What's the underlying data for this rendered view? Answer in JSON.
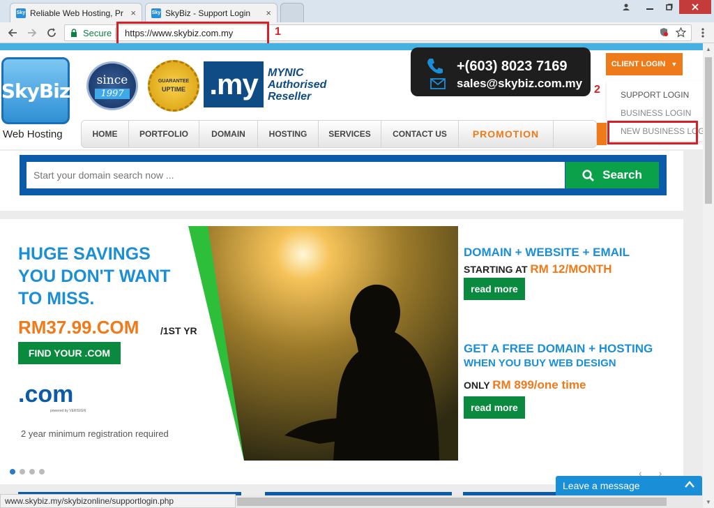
{
  "browser": {
    "tabs": [
      {
        "title": "Reliable Web Hosting, Pr",
        "favicon": "skybiz-favicon"
      },
      {
        "title": "SkyBiz - Support Login",
        "favicon": "skybiz-favicon"
      }
    ],
    "close_glyph": "×",
    "address": {
      "secure_label": "Secure",
      "url": "https://www.skybiz.com.my"
    },
    "annotations": {
      "url_marker": "1",
      "support_marker": "2"
    },
    "status_url": "www.skybiz.my/skybizonline/supportlogin.php"
  },
  "header": {
    "logo_text": "SkyBiz",
    "logo_sub": "Web Hosting",
    "since_label": "since",
    "since_year": "1997",
    "guarantee_label": "GUARANTEE",
    "guarantee_sub": "UPTIME",
    "my_badge": ".my",
    "mynic_lines": [
      "MYNIC",
      "Authorised",
      "Reseller"
    ],
    "phone": "+(603) 8023 7169",
    "email": "sales@skybiz.com.my",
    "client_login_label": "CLIENT LOGIN",
    "dropdown": [
      "SUPPORT LOGIN",
      "BUSINESS LOGIN",
      "NEW BUSINESS LOG"
    ],
    "nav": [
      "HOME",
      "PORTFOLIO",
      "DOMAIN",
      "HOSTING",
      "SERVICES",
      "CONTACT US",
      "PROMOTION"
    ]
  },
  "search": {
    "placeholder": "Start your domain search now ...",
    "button_label": "Search"
  },
  "banner": {
    "headline": [
      "HUGE SAVINGS",
      "YOU DON'T WANT",
      "TO MISS."
    ],
    "price_main": "RM37.99.COM",
    "price_suffix": "/1ST YR",
    "find_label": "FIND YOUR .COM",
    "dotcom": ".com",
    "powered_by": "powered by VERISIGN",
    "note": "2 year minimum registration required",
    "offer1_title": "DOMAIN + WEBSITE + EMAIL",
    "offer1_prefix": "STARTING AT",
    "offer1_price": "RM 12/MONTH",
    "offer2_title": "GET A FREE DOMAIN + HOSTING",
    "offer2_sub": "WHEN YOU BUY WEB DESIGN",
    "offer2_prefix": "ONLY",
    "offer2_price": "RM 899/one time",
    "read_more": "read more",
    "slide_index": 1,
    "slide_count": 4
  },
  "chat": {
    "label": "Leave a message"
  },
  "colors": {
    "brand_blue": "#1a8fd8",
    "nav_orange": "#ef7a1a",
    "search_green": "#0aa14a",
    "annotation_red": "#d81f26"
  }
}
